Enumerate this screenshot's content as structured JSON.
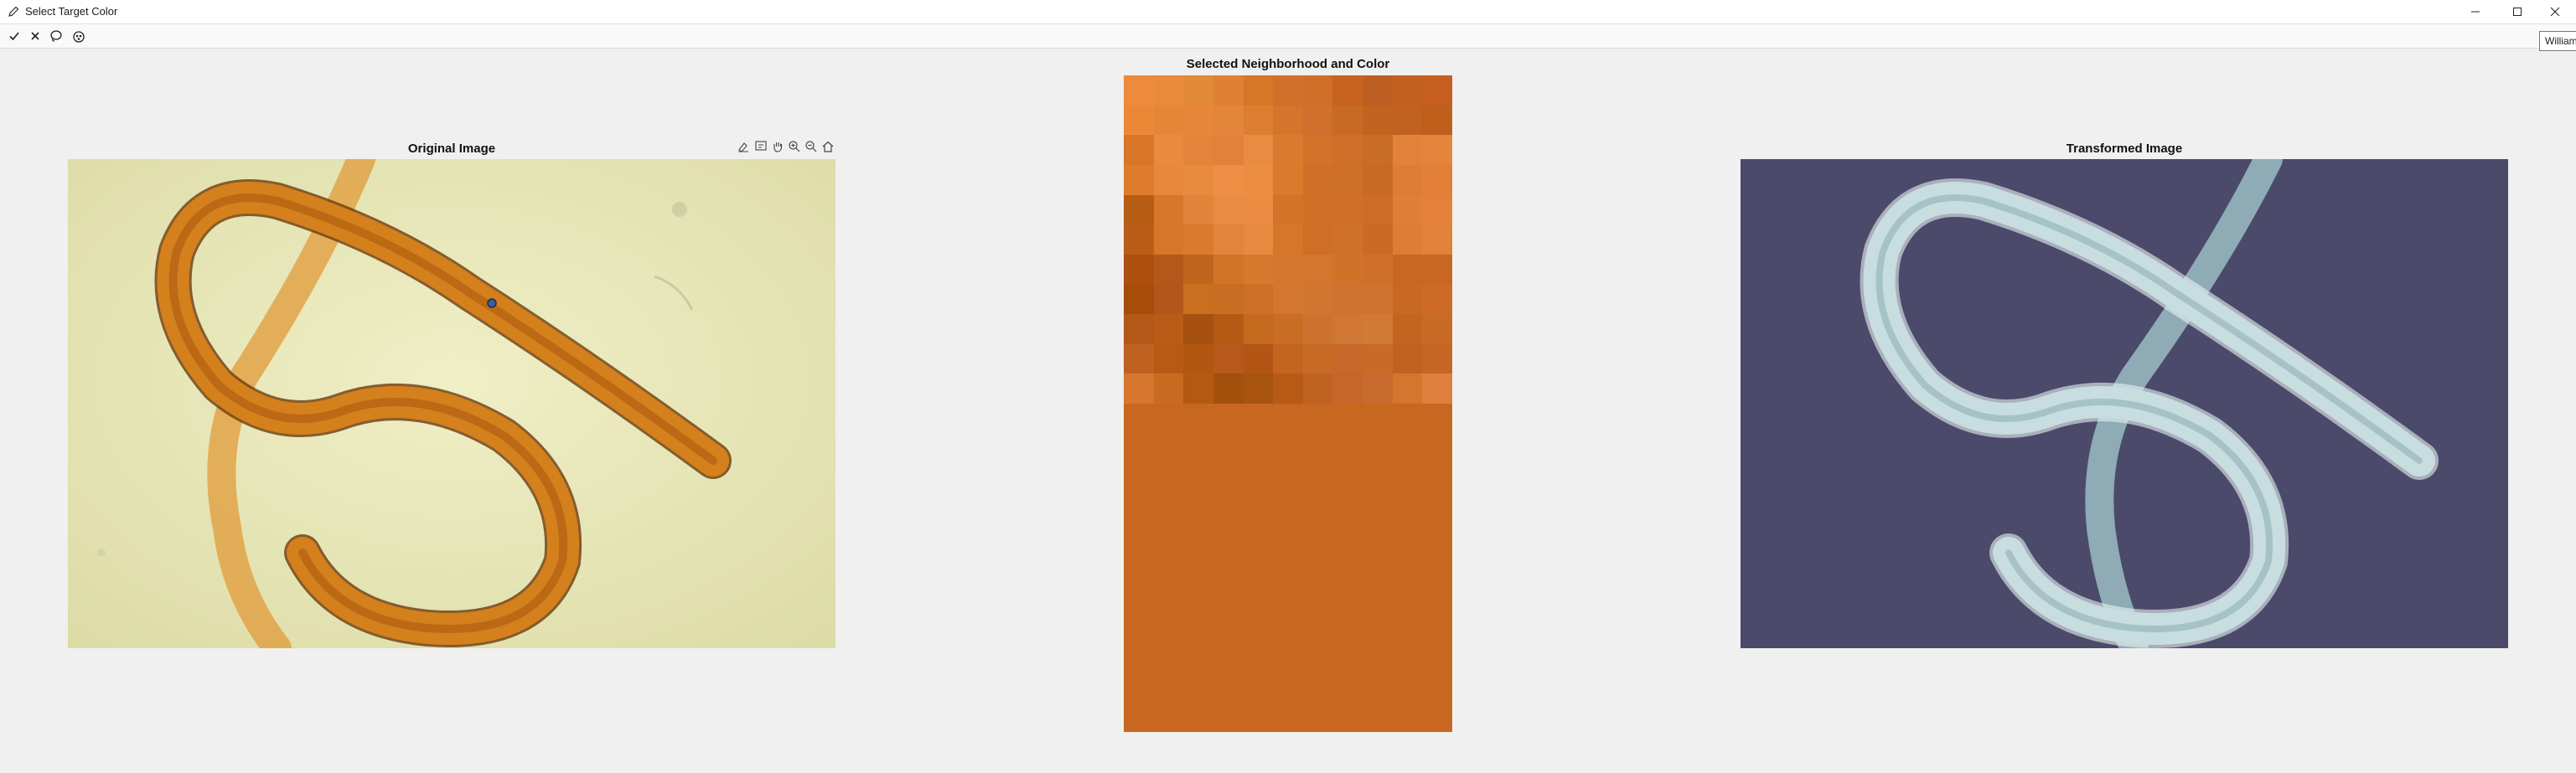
{
  "window": {
    "title": "Select Target Color",
    "icons": {
      "app": "pencil-icon",
      "minimize": "minimize-icon",
      "maximize": "maximize-icon",
      "close": "close-icon"
    }
  },
  "toolbar": {
    "buttons": [
      {
        "name": "accept-icon"
      },
      {
        "name": "cancel-icon"
      },
      {
        "name": "lasso-icon"
      },
      {
        "name": "color-picker-icon"
      }
    ]
  },
  "tooltip": {
    "text": "William"
  },
  "axes": {
    "original_title": "Original Image",
    "neighborhood_title": "Selected Neighborhood and Color",
    "transformed_title": "Transformed Image",
    "axes_toolbar": [
      "brush-icon",
      "datatip-icon",
      "pan-hand-icon",
      "zoom-in-icon",
      "zoom-out-icon",
      "home-icon"
    ]
  },
  "colors": {
    "selected_color": "#c8671f",
    "original_background": "#e2e1b0",
    "worm_orange": "#d6871e",
    "transformed_background": "#4b4a6a",
    "transformed_worm": "#c7dde0",
    "marker": "#3a5f92"
  },
  "neighborhood": {
    "pixels": [
      [
        "#ee8a3c",
        "#e9893a",
        "#e38a37",
        "#df8033",
        "#d87628",
        "#d0702a",
        "#cf6e27",
        "#c8621f",
        "#bd5f22",
        "#c2601f",
        "#c65f1f"
      ],
      [
        "#ec8735",
        "#e58636",
        "#e7873a",
        "#e3863a",
        "#dd7e30",
        "#d5742b",
        "#d0702c",
        "#c86a24",
        "#c26322",
        "#c26221",
        "#c05f1c"
      ],
      [
        "#d97628",
        "#ea8a3e",
        "#e3843a",
        "#e28139",
        "#e88c42",
        "#d97a2f",
        "#d37329",
        "#cf6e28",
        "#c86d26",
        "#e2823b",
        "#e5853c"
      ],
      [
        "#df7c2b",
        "#e7883b",
        "#e78a3c",
        "#ee8f45",
        "#ed8d40",
        "#d97a2c",
        "#d07028",
        "#cd6f25",
        "#c96a24",
        "#e07d35",
        "#e37f37"
      ],
      [
        "#b75c13",
        "#d87729",
        "#e0843a",
        "#e88c42",
        "#ec8c42",
        "#d47328",
        "#d07026",
        "#cf6e25",
        "#cc6c27",
        "#e27f37",
        "#e5803a"
      ],
      [
        "#ba5e17",
        "#d67628",
        "#d97a2e",
        "#e3843b",
        "#e78a40",
        "#d57628",
        "#cf6f26",
        "#d07128",
        "#ca6a26",
        "#de7d35",
        "#e1813a"
      ],
      [
        "#ad500f",
        "#b4571a",
        "#c0651e",
        "#d27426",
        "#d77a2d",
        "#d4772e",
        "#d3772e",
        "#cf7329",
        "#cf6f29",
        "#ca6624",
        "#c86623"
      ],
      [
        "#a84c0a",
        "#b2571c",
        "#c8701f",
        "#c86e23",
        "#cd6f25",
        "#d27630",
        "#d07630",
        "#cf7430",
        "#cf7330",
        "#c86824",
        "#cc6a26"
      ],
      [
        "#b4581a",
        "#b85c17",
        "#a6510f",
        "#b35a14",
        "#c46a1c",
        "#c86d24",
        "#cd7330",
        "#d07736",
        "#d17936",
        "#c26520",
        "#c76b26"
      ],
      [
        "#bf6120",
        "#b85a15",
        "#b25712",
        "#b7591a",
        "#b35514",
        "#c3651f",
        "#c86b27",
        "#c8692b",
        "#c96a28",
        "#c06322",
        "#c66624"
      ],
      [
        "#d7772e",
        "#c96b21",
        "#b45912",
        "#a4500d",
        "#a85310",
        "#b75a16",
        "#bf6322",
        "#c5672a",
        "#c86b2e",
        "#d5762e",
        "#e0803e"
      ]
    ]
  }
}
